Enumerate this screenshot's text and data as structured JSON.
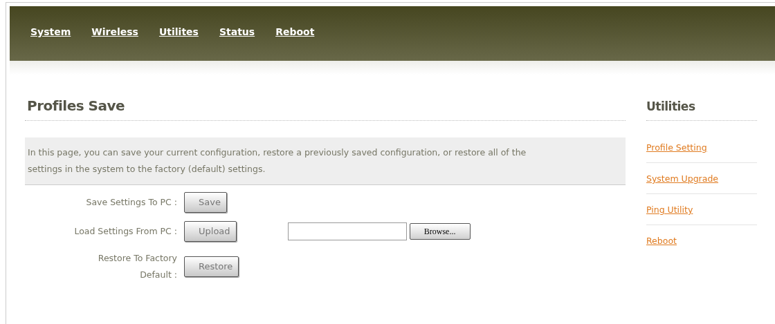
{
  "nav": [
    {
      "label": "System"
    },
    {
      "label": "Wireless"
    },
    {
      "label": "Utilites"
    },
    {
      "label": "Status"
    },
    {
      "label": "Reboot"
    }
  ],
  "title": "Profiles Save",
  "description": "In this page, you can save your current configuration, restore a previously saved configuration, or restore all of the settings in the system to the factory (default) settings.",
  "rows": [
    {
      "label": "Save Settings To PC :",
      "button": "Save",
      "kind": "button"
    },
    {
      "label": "Load Settings From PC :",
      "button": "Upload",
      "kind": "file",
      "browse": "Browse..."
    },
    {
      "label": "Restore To Factory Default :",
      "button": "Restore",
      "kind": "button"
    }
  ],
  "sidebar": {
    "title": "Utilities",
    "items": [
      {
        "label": "Profile Setting"
      },
      {
        "label": "System Upgrade"
      },
      {
        "label": "Ping Utility"
      },
      {
        "label": "Reboot"
      }
    ]
  }
}
